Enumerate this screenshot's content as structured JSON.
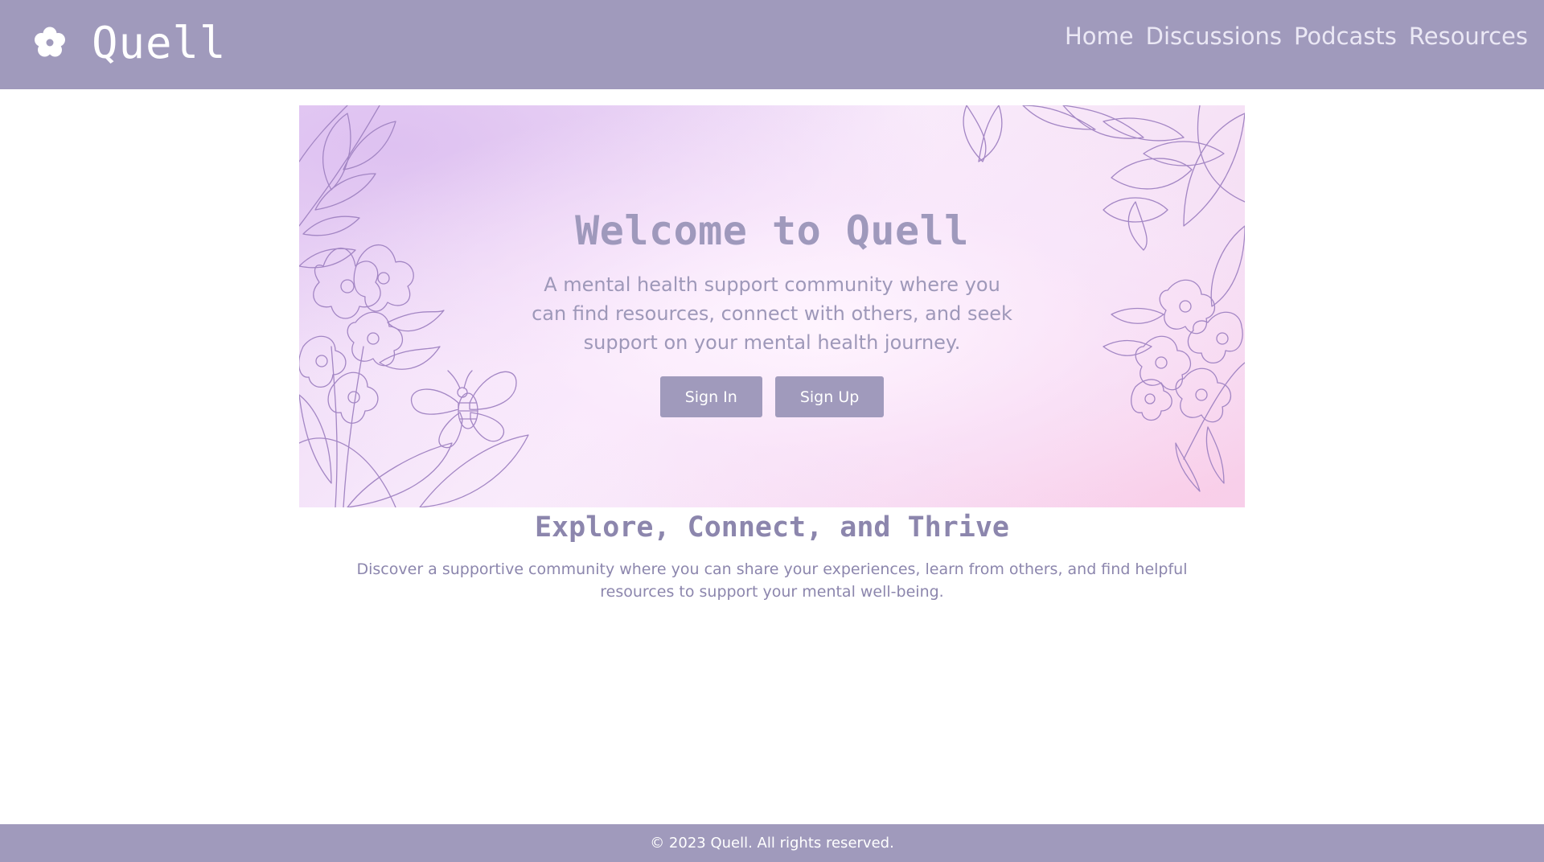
{
  "header": {
    "logo_icon": "flower-icon",
    "brand_name": "Quell",
    "nav": [
      "Home",
      "Discussions",
      "Podcasts",
      "Resources"
    ]
  },
  "hero": {
    "title": "Welcome to Quell",
    "text": "A mental health support community where you can find resources, connect with others, and seek support on your mental health journey.",
    "sign_in_label": "Sign In",
    "sign_up_label": "Sign Up",
    "decoration": [
      "floral-line-art",
      "bee-illustration"
    ]
  },
  "section": {
    "title": "Explore, Connect, and Thrive",
    "text": "Discover a supportive community where you can share your experiences, learn from others, and find helpful resources to support your mental well-being."
  },
  "footer": {
    "copyright": "© 2023 Quell. All rights reserved."
  },
  "colors": {
    "primary": "#a09abc",
    "text_accent": "#8c86ad",
    "background": "#ffffff"
  }
}
